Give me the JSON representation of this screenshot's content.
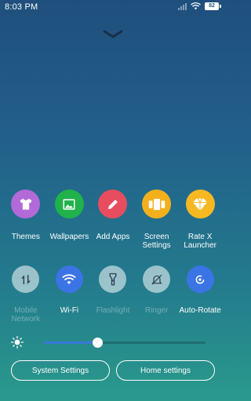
{
  "status_bar": {
    "time": "8:03 PM",
    "battery": "82",
    "icons": [
      "signal-icon",
      "wifi-icon",
      "battery-icon"
    ]
  },
  "handle": {
    "icon": "chevron-down-icon"
  },
  "apps": [
    {
      "label": "Themes",
      "icon": "tshirt-icon",
      "color": "#b16ad8"
    },
    {
      "label": "Wallpapers",
      "icon": "image-icon",
      "color": "#21b24b"
    },
    {
      "label": "Add Apps",
      "icon": "pencil-icon",
      "color": "#e74c5f"
    },
    {
      "label": "Screen\nSettings",
      "icon": "screens-icon",
      "color": "#f4b01c"
    },
    {
      "label": "Rate X\nLauncher",
      "icon": "diamond-icon",
      "color": "#f7b822"
    }
  ],
  "toggles": [
    {
      "label": "Mobile\nNetwork",
      "icon": "mobile-data-icon",
      "state": "off"
    },
    {
      "label": "Wi-Fi",
      "icon": "wifi-icon",
      "state": "on",
      "color": "#3b74e4"
    },
    {
      "label": "Flashlight",
      "icon": "flashlight-icon",
      "state": "off"
    },
    {
      "label": "Ringer",
      "icon": "ringer-off-icon",
      "state": "off"
    },
    {
      "label": "Auto-Rotate",
      "icon": "auto-rotate-icon",
      "state": "on",
      "color": "#3b74e4"
    }
  ],
  "brightness": {
    "icon": "sun-icon",
    "level": 0.33
  },
  "buttons": {
    "system_settings": "System Settings",
    "home_settings": "Home settings"
  }
}
